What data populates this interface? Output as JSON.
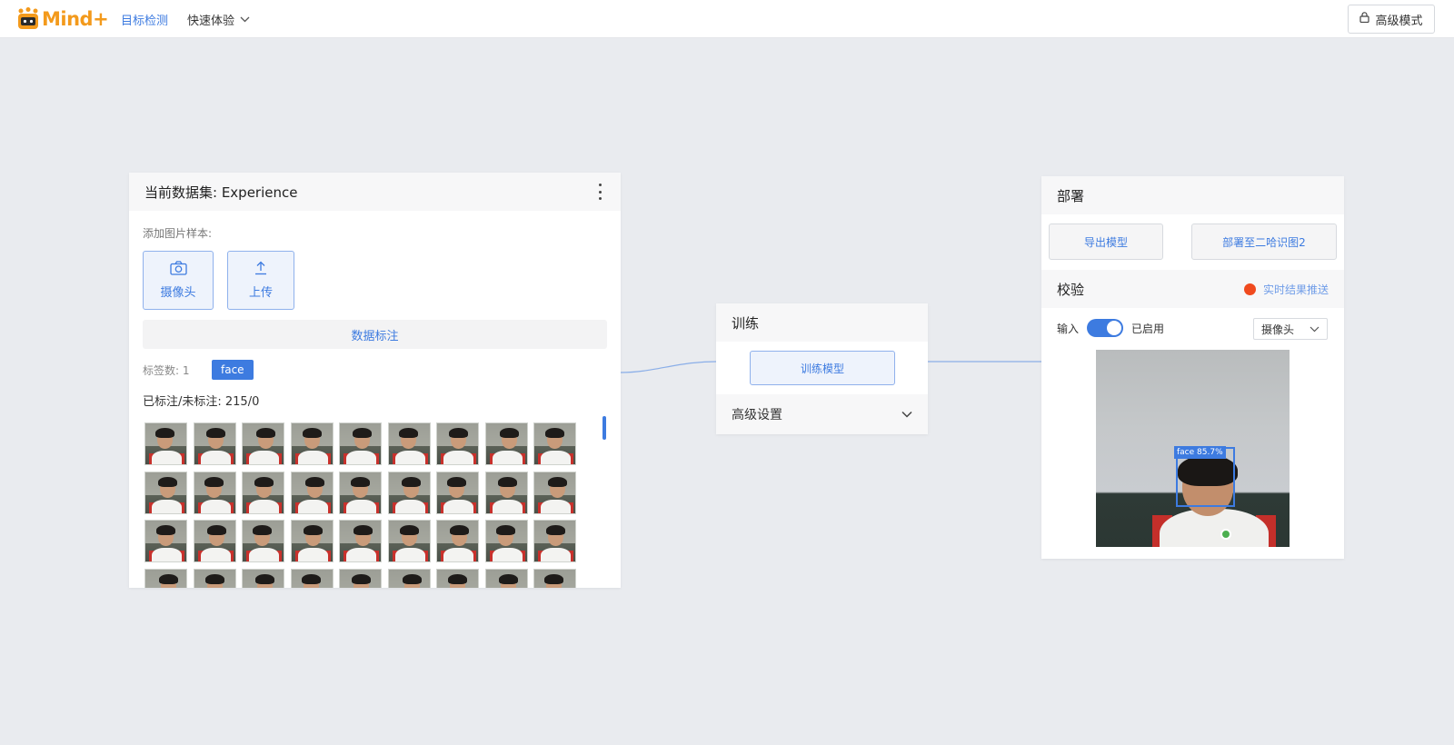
{
  "app": {
    "logo_text": "Mind+",
    "nav_active": "目标检测",
    "nav_menu": "快速体验",
    "advanced_mode": "高级模式"
  },
  "dataset": {
    "title": "当前数据集: Experience",
    "add_samples_label": "添加图片样本:",
    "camera_button": "摄像头",
    "upload_button": "上传",
    "annotate_button": "数据标注",
    "tag_count_label": "标签数: 1",
    "tags": [
      "face"
    ],
    "label_stat": "已标注/未标注: 215/0",
    "thumbnail_count": 36
  },
  "train": {
    "title": "训练",
    "train_button": "训练模型",
    "advanced_settings": "高级设置"
  },
  "deploy": {
    "title": "部署",
    "export_button": "导出模型",
    "push_button": "部署至二哈识图2",
    "verify_title": "校验",
    "realtime_push": "实时结果推送",
    "input_label": "输入",
    "enabled_label": "已启用",
    "input_source": "摄像头",
    "detection_label": "face 85.7%"
  },
  "colors": {
    "accent": "#3d7be0",
    "brand": "#f39a1c",
    "status_red": "#f04a1e",
    "background": "#e9ebef"
  },
  "icons": [
    "lock-icon",
    "chevron-down-icon",
    "more-vertical-icon",
    "camera-icon",
    "upload-icon"
  ]
}
